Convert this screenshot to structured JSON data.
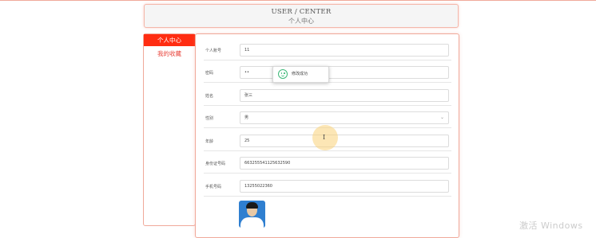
{
  "header": {
    "title_en": "USER / CENTER",
    "title_cn": "个人中心"
  },
  "sidebar": {
    "items": [
      {
        "label": "个人中心",
        "active": true
      },
      {
        "label": "我的收藏",
        "active": false
      }
    ]
  },
  "form": {
    "fields": [
      {
        "label": "个人账号",
        "value": "11"
      },
      {
        "label": "密码",
        "value": "••"
      },
      {
        "label": "姓名",
        "value": "张三"
      },
      {
        "label": "性别",
        "value": "男",
        "type": "select"
      },
      {
        "label": "年龄",
        "value": "25"
      },
      {
        "label": "身份证号码",
        "value": "663255541125632590"
      },
      {
        "label": "手机号码",
        "value": "13255022360"
      }
    ]
  },
  "toast": {
    "message": "修改成功",
    "icon": "smile-icon"
  },
  "watermark": "激活 Windows",
  "colors": {
    "accent": "#ff2d12",
    "sidebar_text": "#e8453c",
    "success": "#3fb979"
  }
}
